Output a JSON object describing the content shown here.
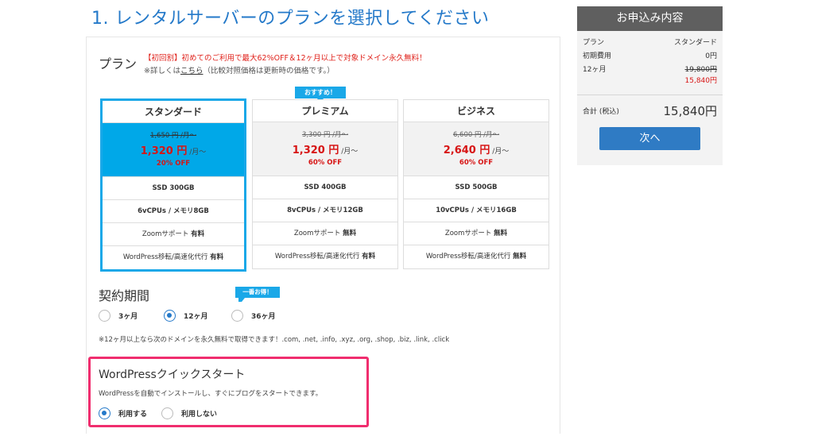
{
  "page_title": "1. レンタルサーバーのプランを選択してください",
  "plan_section": {
    "label": "プラン",
    "campaign": "【初回割】初めてのご利用で最大62%OFF＆12ヶ月以上で対象ドメイン永久無料！",
    "note_prefix": "※詳しくは",
    "note_link": "こちら",
    "note_suffix": "（比較対照価格は更新時の価格です。）",
    "recommended_badge": "おすすめ！"
  },
  "plans": [
    {
      "name": "スタンダード",
      "old_price": "1,650 円 /月〜",
      "new_price": "1,320 円",
      "per_month": " /月〜",
      "discount": "20% OFF",
      "ssd": "SSD 300GB",
      "cpu": "6vCPUs / メモリ8GB",
      "zoom_label": "Zoomサポート ",
      "zoom_value": "有料",
      "wp_label": "WordPress移転/高速化代行 ",
      "wp_value": "有料"
    },
    {
      "name": "プレミアム",
      "old_price": "3,300 円 /月〜",
      "new_price": "1,320 円",
      "per_month": " /月〜",
      "discount": "60% OFF",
      "ssd": "SSD 400GB",
      "cpu": "8vCPUs / メモリ12GB",
      "zoom_label": "Zoomサポート ",
      "zoom_value": "無料",
      "wp_label": "WordPress移転/高速化代行 ",
      "wp_value": "有料"
    },
    {
      "name": "ビジネス",
      "old_price": "6,600 円 /月〜",
      "new_price": "2,640 円",
      "per_month": " /月〜",
      "discount": "60% OFF",
      "ssd": "SSD 500GB",
      "cpu": "10vCPUs / メモリ16GB",
      "zoom_label": "Zoomサポート ",
      "zoom_value": "無料",
      "wp_label": "WordPress移転/高速化代行 ",
      "wp_value": "無料"
    }
  ],
  "period": {
    "label": "契約期間",
    "best_badge": "一番お得！",
    "options": [
      "3ヶ月",
      "12ヶ月",
      "36ヶ月"
    ],
    "selected": "12ヶ月",
    "domain_note": "※12ヶ月以上なら次のドメインを永久無料で取得できます！.com, .net, .info, .xyz, .org, .shop, .biz, .link, .click"
  },
  "wp_quick": {
    "title": "WordPressクイックスタート",
    "desc": "WordPressを自動でインストールし、すぐにブログをスタートできます。",
    "options": [
      "利用する",
      "利用しない"
    ],
    "selected": "利用する"
  },
  "order": {
    "title": "お申込み内容",
    "plan_label": "プラン",
    "plan_value": "スタンダード",
    "initial_label": "初期費用",
    "initial_value": "0円",
    "term_label": "12ヶ月",
    "term_old": "19,800円",
    "term_new": "15,840円",
    "total_label": "合計 (税込)",
    "total_value": "15,840円",
    "next_button": "次へ"
  },
  "colors": {
    "accent_blue": "#2479c9",
    "selected_plan": "#00a8e8",
    "price_red": "#d71515",
    "highlight_pink": "#f02d6e"
  }
}
